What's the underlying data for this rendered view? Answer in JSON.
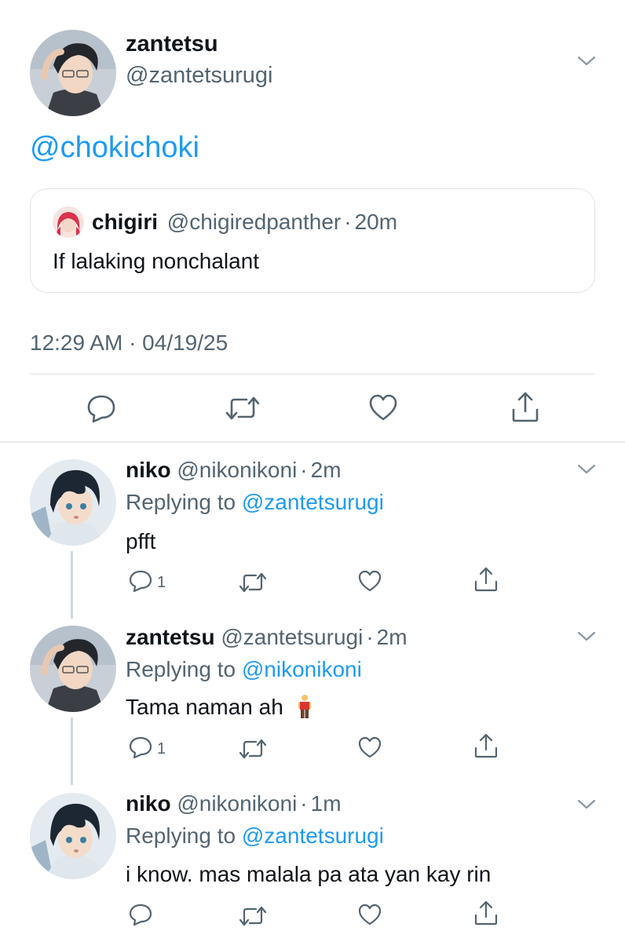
{
  "main_tweet": {
    "author_name": "zantetsu",
    "author_handle": "@zantetsurugi",
    "text": "@chokichoki",
    "quote": {
      "author_name": "chigiri",
      "author_handle": "@chigiredpanther",
      "separator": "·",
      "time": "20m",
      "text": "If lalaking nonchalant"
    },
    "timestamp": "12:29 AM · 04/19/25",
    "actions": [
      "reply-icon",
      "retweet-icon",
      "like-icon",
      "share-icon"
    ]
  },
  "replies": [
    {
      "author_name": "niko",
      "author_handle": "@nikonikoni",
      "separator": "·",
      "time": "2m",
      "replying_prefix": "Replying to",
      "replying_to": "@zantetsurugi",
      "text": "pfft",
      "reply_count": "1"
    },
    {
      "author_name": "zantetsu",
      "author_handle": "@zantetsurugi",
      "separator": "·",
      "time": "2m",
      "replying_prefix": "Replying to",
      "replying_to": "@nikonikoni",
      "text": "Tama naman ah",
      "emoji": "person-standing-emoji",
      "reply_count": "1"
    },
    {
      "author_name": "niko",
      "author_handle": "@nikonikoni",
      "separator": "·",
      "time": "1m",
      "replying_prefix": "Replying to",
      "replying_to": "@zantetsurugi",
      "text": "i know. mas malala pa ata yan kay rin",
      "reply_count": ""
    }
  ],
  "colors": {
    "link": "#1d9bf0",
    "secondary_text": "#536471",
    "primary_text": "#0f1419",
    "divider": "#dfe3e7",
    "thread_line": "#cfd9de"
  }
}
